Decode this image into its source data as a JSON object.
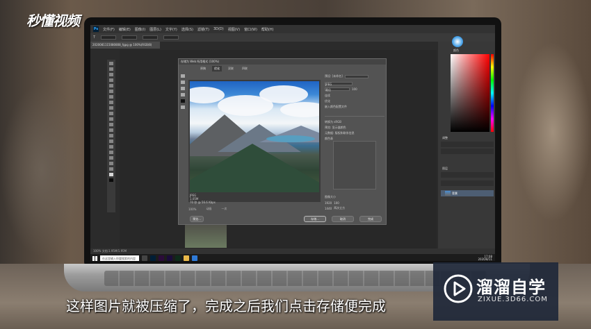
{
  "brand": {
    "text": "秒懂视频"
  },
  "subtitle": "这样图片就被压缩了，完成之后我们点击存储便完成",
  "watermark": {
    "name": "溜溜自学",
    "url": "ZIXUE.3D66.COM"
  },
  "photoshop": {
    "menu": [
      "文件(F)",
      "编辑(E)",
      "图像(I)",
      "图层(L)",
      "文字(Y)",
      "选择(S)",
      "滤镜(T)",
      "3D(D)",
      "视图(V)",
      "窗口(W)",
      "帮助(H)"
    ],
    "doc_tab": "2020081115080808_fgpg @ 100%(RGB/8)",
    "status": "100%   文档:1.95M/1.95M",
    "panels": {
      "color_label": "颜色",
      "adjust_label": "调整",
      "layers_label": "图层",
      "layer_name": "背景"
    }
  },
  "dialog": {
    "title": "存储为 Web 所用格式 (100%)",
    "tabs": [
      "原稿",
      "优化",
      "双联",
      "四联"
    ],
    "active_tab": "优化",
    "preview_info": [
      "JPEG",
      "1.05M",
      "70 秒 @ 56.6 Kbps"
    ],
    "preset_label": "预设: [未命名]",
    "format": "JPEG",
    "quality": "最佳",
    "quality_value": "100",
    "checkboxes": [
      "连续",
      "优化",
      "嵌入颜色配置文件"
    ],
    "convert_srgb": "转换为 sRGB",
    "preview_label": "预览: 显示器颜色",
    "metadata_label": "元数据: 版权和联系信息",
    "color_table_label": "颜色表",
    "image_size_label": "图像大小",
    "width": "1920",
    "height": "1440",
    "percent": "100",
    "quality_mode": "两次立方",
    "animation_label": "动画",
    "loop": "一次",
    "zoom": "100%",
    "buttons": {
      "preview": "预览...",
      "save": "存储...",
      "cancel": "取消",
      "done": "完成"
    }
  },
  "taskbar": {
    "search_placeholder": "在这里输入你要搜索的内容",
    "time": "17:08",
    "date": "2020/8/11"
  },
  "colors": {
    "accent": "#31a8ff",
    "watermark_bg": "#20283a"
  }
}
